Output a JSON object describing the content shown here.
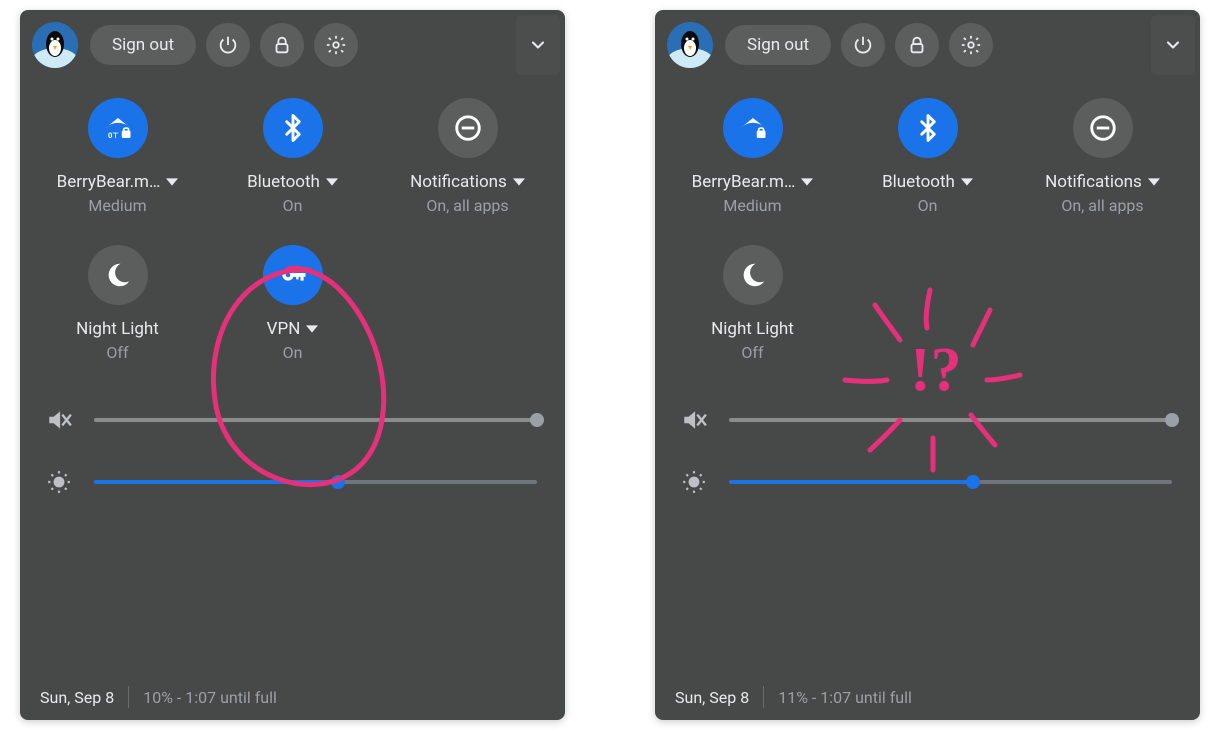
{
  "annotation_color": "#e6307a",
  "panels": [
    {
      "id": "left",
      "topbar": {
        "sign_out": "Sign out"
      },
      "toggles": [
        {
          "key": "wifi",
          "icon": "wifi-lock",
          "on": true,
          "label": "BerryBear.m…",
          "chevron": true,
          "status": "Medium"
        },
        {
          "key": "bluetooth",
          "icon": "bluetooth",
          "on": true,
          "label": "Bluetooth",
          "chevron": true,
          "status": "On"
        },
        {
          "key": "notifications",
          "icon": "dnd",
          "on": false,
          "label": "Notifications",
          "chevron": true,
          "status": "On, all apps"
        },
        {
          "key": "nightlight",
          "icon": "nightlight",
          "on": false,
          "label": "Night Light",
          "chevron": false,
          "status": "Off"
        },
        {
          "key": "vpn",
          "icon": "vpn-key",
          "on": true,
          "label": "VPN",
          "chevron": true,
          "status": "On"
        }
      ],
      "sliders": {
        "volume": 100,
        "volume_muted": true,
        "brightness": 55
      },
      "footer": {
        "date": "Sun, Sep 8",
        "battery": "10% - 1:07 until full"
      },
      "annotation": {
        "type": "circle",
        "target": "vpn"
      }
    },
    {
      "id": "right",
      "topbar": {
        "sign_out": "Sign out"
      },
      "toggles": [
        {
          "key": "wifi",
          "icon": "wifi-lock",
          "on": true,
          "label": "BerryBear.m…",
          "chevron": true,
          "status": "Medium"
        },
        {
          "key": "bluetooth",
          "icon": "bluetooth",
          "on": true,
          "label": "Bluetooth",
          "chevron": true,
          "status": "On"
        },
        {
          "key": "notifications",
          "icon": "dnd",
          "on": false,
          "label": "Notifications",
          "chevron": true,
          "status": "On, all apps"
        },
        {
          "key": "nightlight",
          "icon": "nightlight",
          "on": false,
          "label": "Night Light",
          "chevron": false,
          "status": "Off"
        }
      ],
      "sliders": {
        "volume": 100,
        "volume_muted": true,
        "brightness": 55
      },
      "footer": {
        "date": "Sun, Sep 8",
        "battery": "11% - 1:07 until full"
      },
      "annotation": {
        "type": "confused",
        "text": "!?"
      }
    }
  ]
}
